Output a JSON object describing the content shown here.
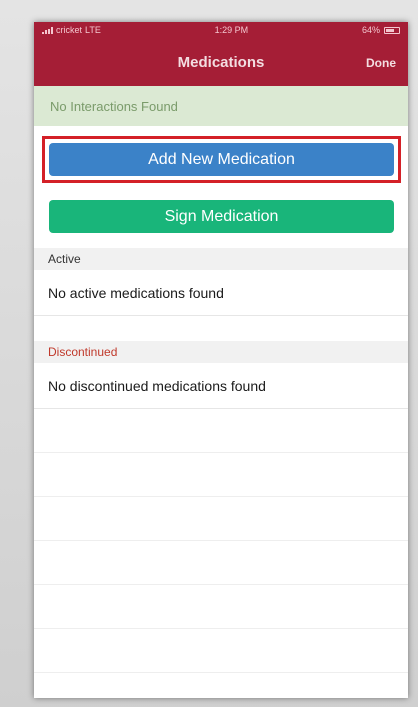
{
  "status_bar": {
    "carrier": "cricket",
    "network": "LTE",
    "time": "1:29 PM",
    "battery": "64%"
  },
  "nav": {
    "title": "Medications",
    "done_label": "Done"
  },
  "banner": {
    "text": "No Interactions Found"
  },
  "buttons": {
    "add_label": "Add New Medication",
    "sign_label": "Sign Medication"
  },
  "sections": {
    "active": {
      "header": "Active",
      "empty_text": "No active medications found"
    },
    "discontinued": {
      "header": "Discontinued",
      "empty_text": "No discontinued medications found"
    }
  },
  "colors": {
    "nav_background": "#a51e36",
    "banner_background": "#dbe9d3",
    "add_button": "#3b82c8",
    "sign_button": "#19b57a",
    "highlight": "#d42027",
    "discontinued_header": "#c0392b"
  }
}
